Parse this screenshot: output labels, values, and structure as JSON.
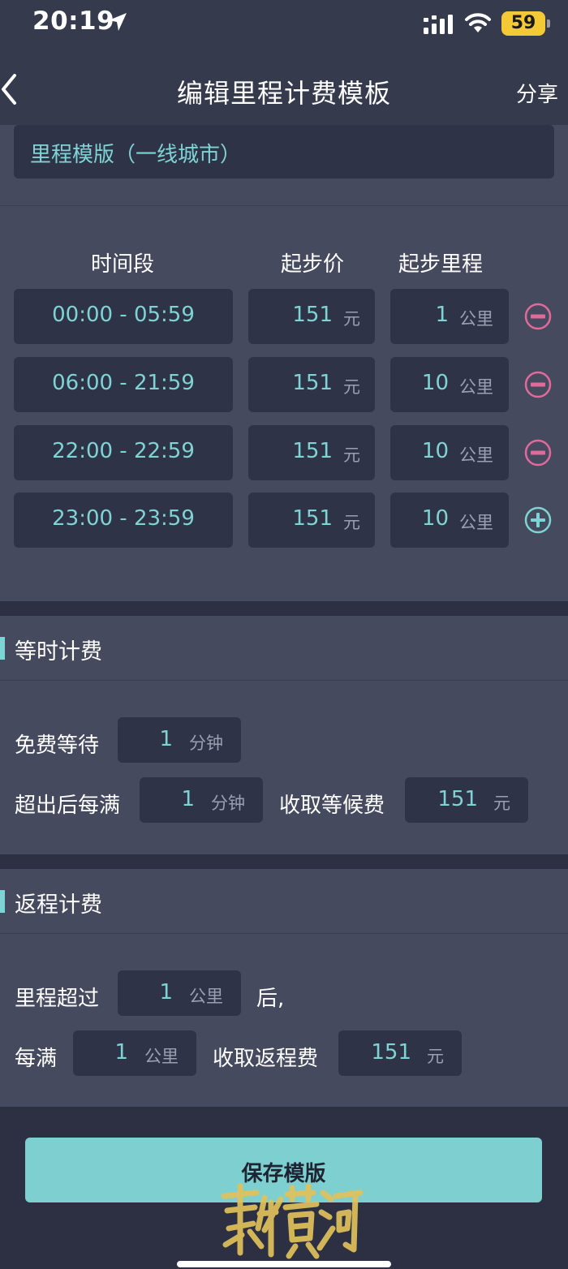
{
  "status_bar": {
    "time": "20:19",
    "battery": "59"
  },
  "nav": {
    "title": "编辑里程计费模板",
    "share_label": "分享"
  },
  "template_name": "里程模版（一线城市）",
  "tiers": {
    "headers": {
      "time": "时间段",
      "price": "起步价",
      "distance": "起步里程"
    },
    "rows": [
      {
        "time": "00:00 - 05:59",
        "price": "151",
        "price_unit": "元",
        "distance": "1",
        "distance_unit": "公里",
        "action": "remove"
      },
      {
        "time": "06:00 - 21:59",
        "price": "151",
        "price_unit": "元",
        "distance": "10",
        "distance_unit": "公里",
        "action": "remove"
      },
      {
        "time": "22:00 - 22:59",
        "price": "151",
        "price_unit": "元",
        "distance": "10",
        "distance_unit": "公里",
        "action": "remove"
      },
      {
        "time": "23:00 - 23:59",
        "price": "151",
        "price_unit": "元",
        "distance": "10",
        "distance_unit": "公里",
        "action": "add"
      }
    ]
  },
  "waiting": {
    "title": "等时计费",
    "free_wait_label": "免费等待",
    "free_wait_value": "1",
    "free_wait_unit": "分钟",
    "every_label": "超出后每满",
    "every_value": "1",
    "every_unit": "分钟",
    "charge_label": "收取等候费",
    "charge_value": "151",
    "charge_unit": "元"
  },
  "return_trip": {
    "title": "返程计费",
    "exceed_label": "里程超过",
    "exceed_value": "1",
    "exceed_unit": "公里",
    "exceed_suffix": "后,",
    "every_label": "每满",
    "every_value": "1",
    "every_unit": "公里",
    "charge_label": "收取返程费",
    "charge_value": "151",
    "charge_unit": "元"
  },
  "save_label": "保存模版",
  "watermark_text": "新黄河",
  "colors": {
    "accent": "#7ed4d4",
    "remove": "#e06a9a",
    "background": "#464a5e",
    "field": "#2f3347"
  },
  "icons": {
    "location": "location-arrow-icon",
    "signal": "cellular-signal-icon",
    "wifi": "wifi-icon",
    "back": "chevron-left-icon",
    "remove": "minus-circle-icon",
    "add": "plus-circle-icon"
  }
}
